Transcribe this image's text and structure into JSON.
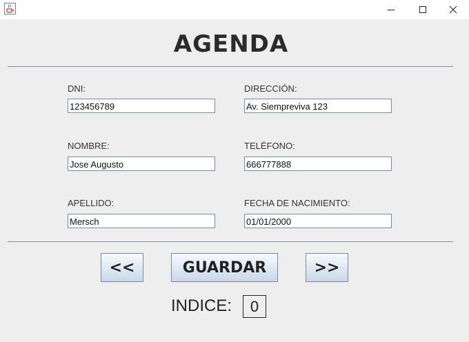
{
  "window": {
    "controls": {
      "minimize_icon": "minimize-icon",
      "maximize_icon": "maximize-icon",
      "close_icon": "close-icon"
    },
    "app_icon": "java-cup-icon"
  },
  "header": {
    "title": "AGENDA"
  },
  "form": {
    "dni": {
      "label": "DNI:",
      "value": "123456789"
    },
    "direccion": {
      "label": "DIRECCIÓN:",
      "value": "Av. Siempreviva 123"
    },
    "nombre": {
      "label": "NOMBRE:",
      "value": "Jose Augusto"
    },
    "telefono": {
      "label": "TELÉFONO:",
      "value": "666777888"
    },
    "apellido": {
      "label": "APELLIDO:",
      "value": "Mersch"
    },
    "fecha": {
      "label": "FECHA DE NACIMIENTO:",
      "value": "01/01/2000"
    }
  },
  "buttons": {
    "prev_label": "<<",
    "save_label": "GUARDAR",
    "next_label": ">>"
  },
  "indice": {
    "label": "INDICE:",
    "value": "0"
  },
  "colors": {
    "background": "#eeeeee",
    "separator": "#7b8fa8",
    "field_border": "#7a8a99"
  }
}
